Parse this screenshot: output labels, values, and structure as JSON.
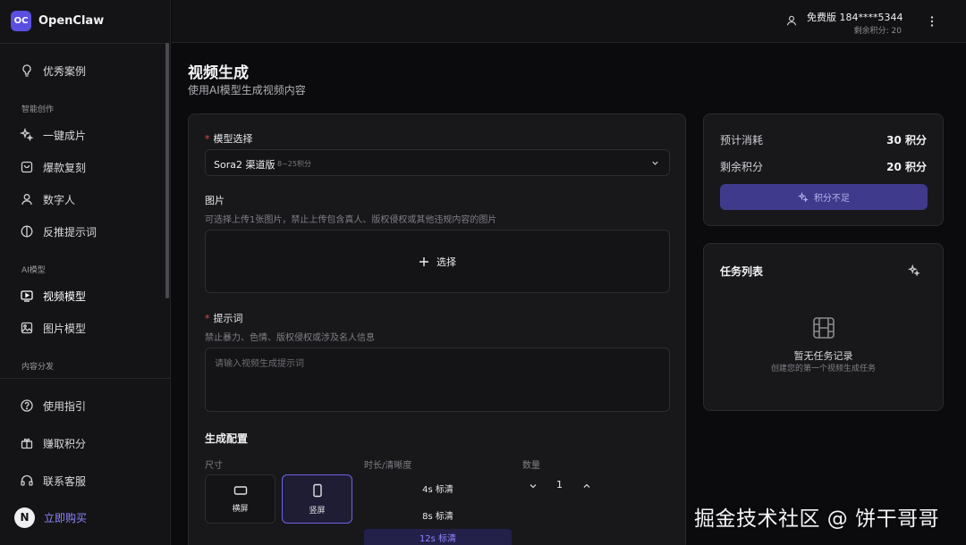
{
  "brand": {
    "logo": "OC",
    "name": "OpenClaw"
  },
  "sidebar": {
    "top_item": {
      "label": "优秀案例",
      "icon": "bulb-icon"
    },
    "sections": [
      {
        "title": "智能创作",
        "items": [
          {
            "label": "一键成片",
            "icon": "sparkle-icon"
          },
          {
            "label": "爆款复刻",
            "icon": "bag-icon"
          },
          {
            "label": "数字人",
            "icon": "person-icon"
          },
          {
            "label": "反推提示词",
            "icon": "contrast-icon"
          }
        ]
      },
      {
        "title": "AI模型",
        "items": [
          {
            "label": "视频模型",
            "icon": "video-icon",
            "active": true
          },
          {
            "label": "图片模型",
            "icon": "image-icon"
          }
        ]
      },
      {
        "title": "内容分发",
        "items": []
      }
    ],
    "bottom_items": [
      {
        "label": "使用指引",
        "icon": "help-circle-icon"
      },
      {
        "label": "赚取积分",
        "icon": "gift-icon"
      },
      {
        "label": "联系客服",
        "icon": "headset-icon"
      },
      {
        "label": "立即购买",
        "icon": "n-badge-icon",
        "badge": "N"
      }
    ]
  },
  "topbar": {
    "plan": "免费版 184****5344",
    "points": "剩余积分: 20"
  },
  "page": {
    "title": "视频生成",
    "subtitle": "使用AI模型生成视频内容"
  },
  "form": {
    "model": {
      "label": "模型选择",
      "value": "Sora2 渠道版",
      "sub": "8~25积分"
    },
    "image": {
      "label": "图片",
      "hint": "可选择上传1张图片，禁止上传包含真人、版权侵权或其他违规内容的图片",
      "button": "选择"
    },
    "prompt": {
      "label": "提示词",
      "hint": "禁止暴力、色情、版权侵权或涉及名人信息",
      "placeholder": "请输入视频生成提示词"
    },
    "config": {
      "title": "生成配置",
      "size_label": "尺寸",
      "sizes": [
        {
          "label": "横屏",
          "selected": false
        },
        {
          "label": "竖屏",
          "selected": true
        }
      ],
      "duration_label": "时长/清晰度",
      "durations": [
        "4s 标清",
        "8s 标清",
        "12s 标清"
      ],
      "quantity_label": "数量",
      "quantity": "1"
    }
  },
  "cost": {
    "estimated_label": "预计消耗",
    "estimated_value": "30 积分",
    "remaining_label": "剩余积分",
    "remaining_value": "20 积分",
    "button": "积分不足"
  },
  "tasks": {
    "title": "任务列表",
    "empty_title": "暂无任务记录",
    "empty_sub": "创建您的第一个视频生成任务"
  },
  "watermark": "掘金技术社区 @ 饼干哥哥",
  "colors": {
    "accent": "#5b4fe0",
    "required": "#e5484d",
    "background": "#0b0b0d"
  }
}
